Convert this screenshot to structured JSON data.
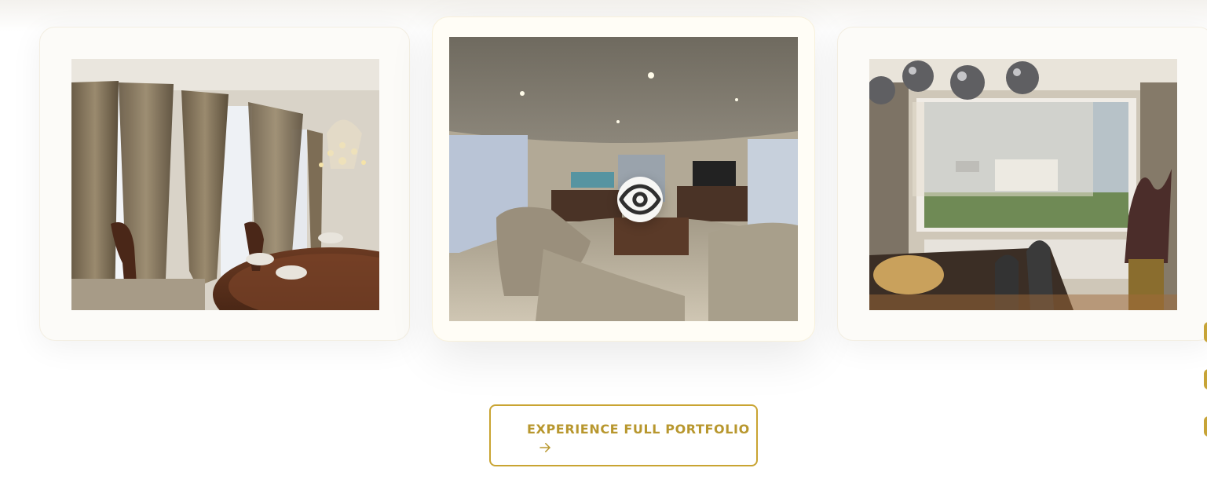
{
  "colors": {
    "accent": "#c9a432",
    "accent_text": "#b8972e",
    "card_bg": "#fcfbf8",
    "page_bg": "#ffffff"
  },
  "gallery": {
    "cards": [
      {
        "photo": "dining-room-with-chandelier",
        "state": "side"
      },
      {
        "photo": "living-room-panorama",
        "state": "active",
        "overlay_icon": "eye-icon"
      },
      {
        "photo": "dining-area-with-window-and-pendant-lights",
        "state": "side"
      }
    ]
  },
  "cta": {
    "label": "EXPERIENCE FULL PORTFOLIO",
    "icon": "arrow-right-icon"
  }
}
